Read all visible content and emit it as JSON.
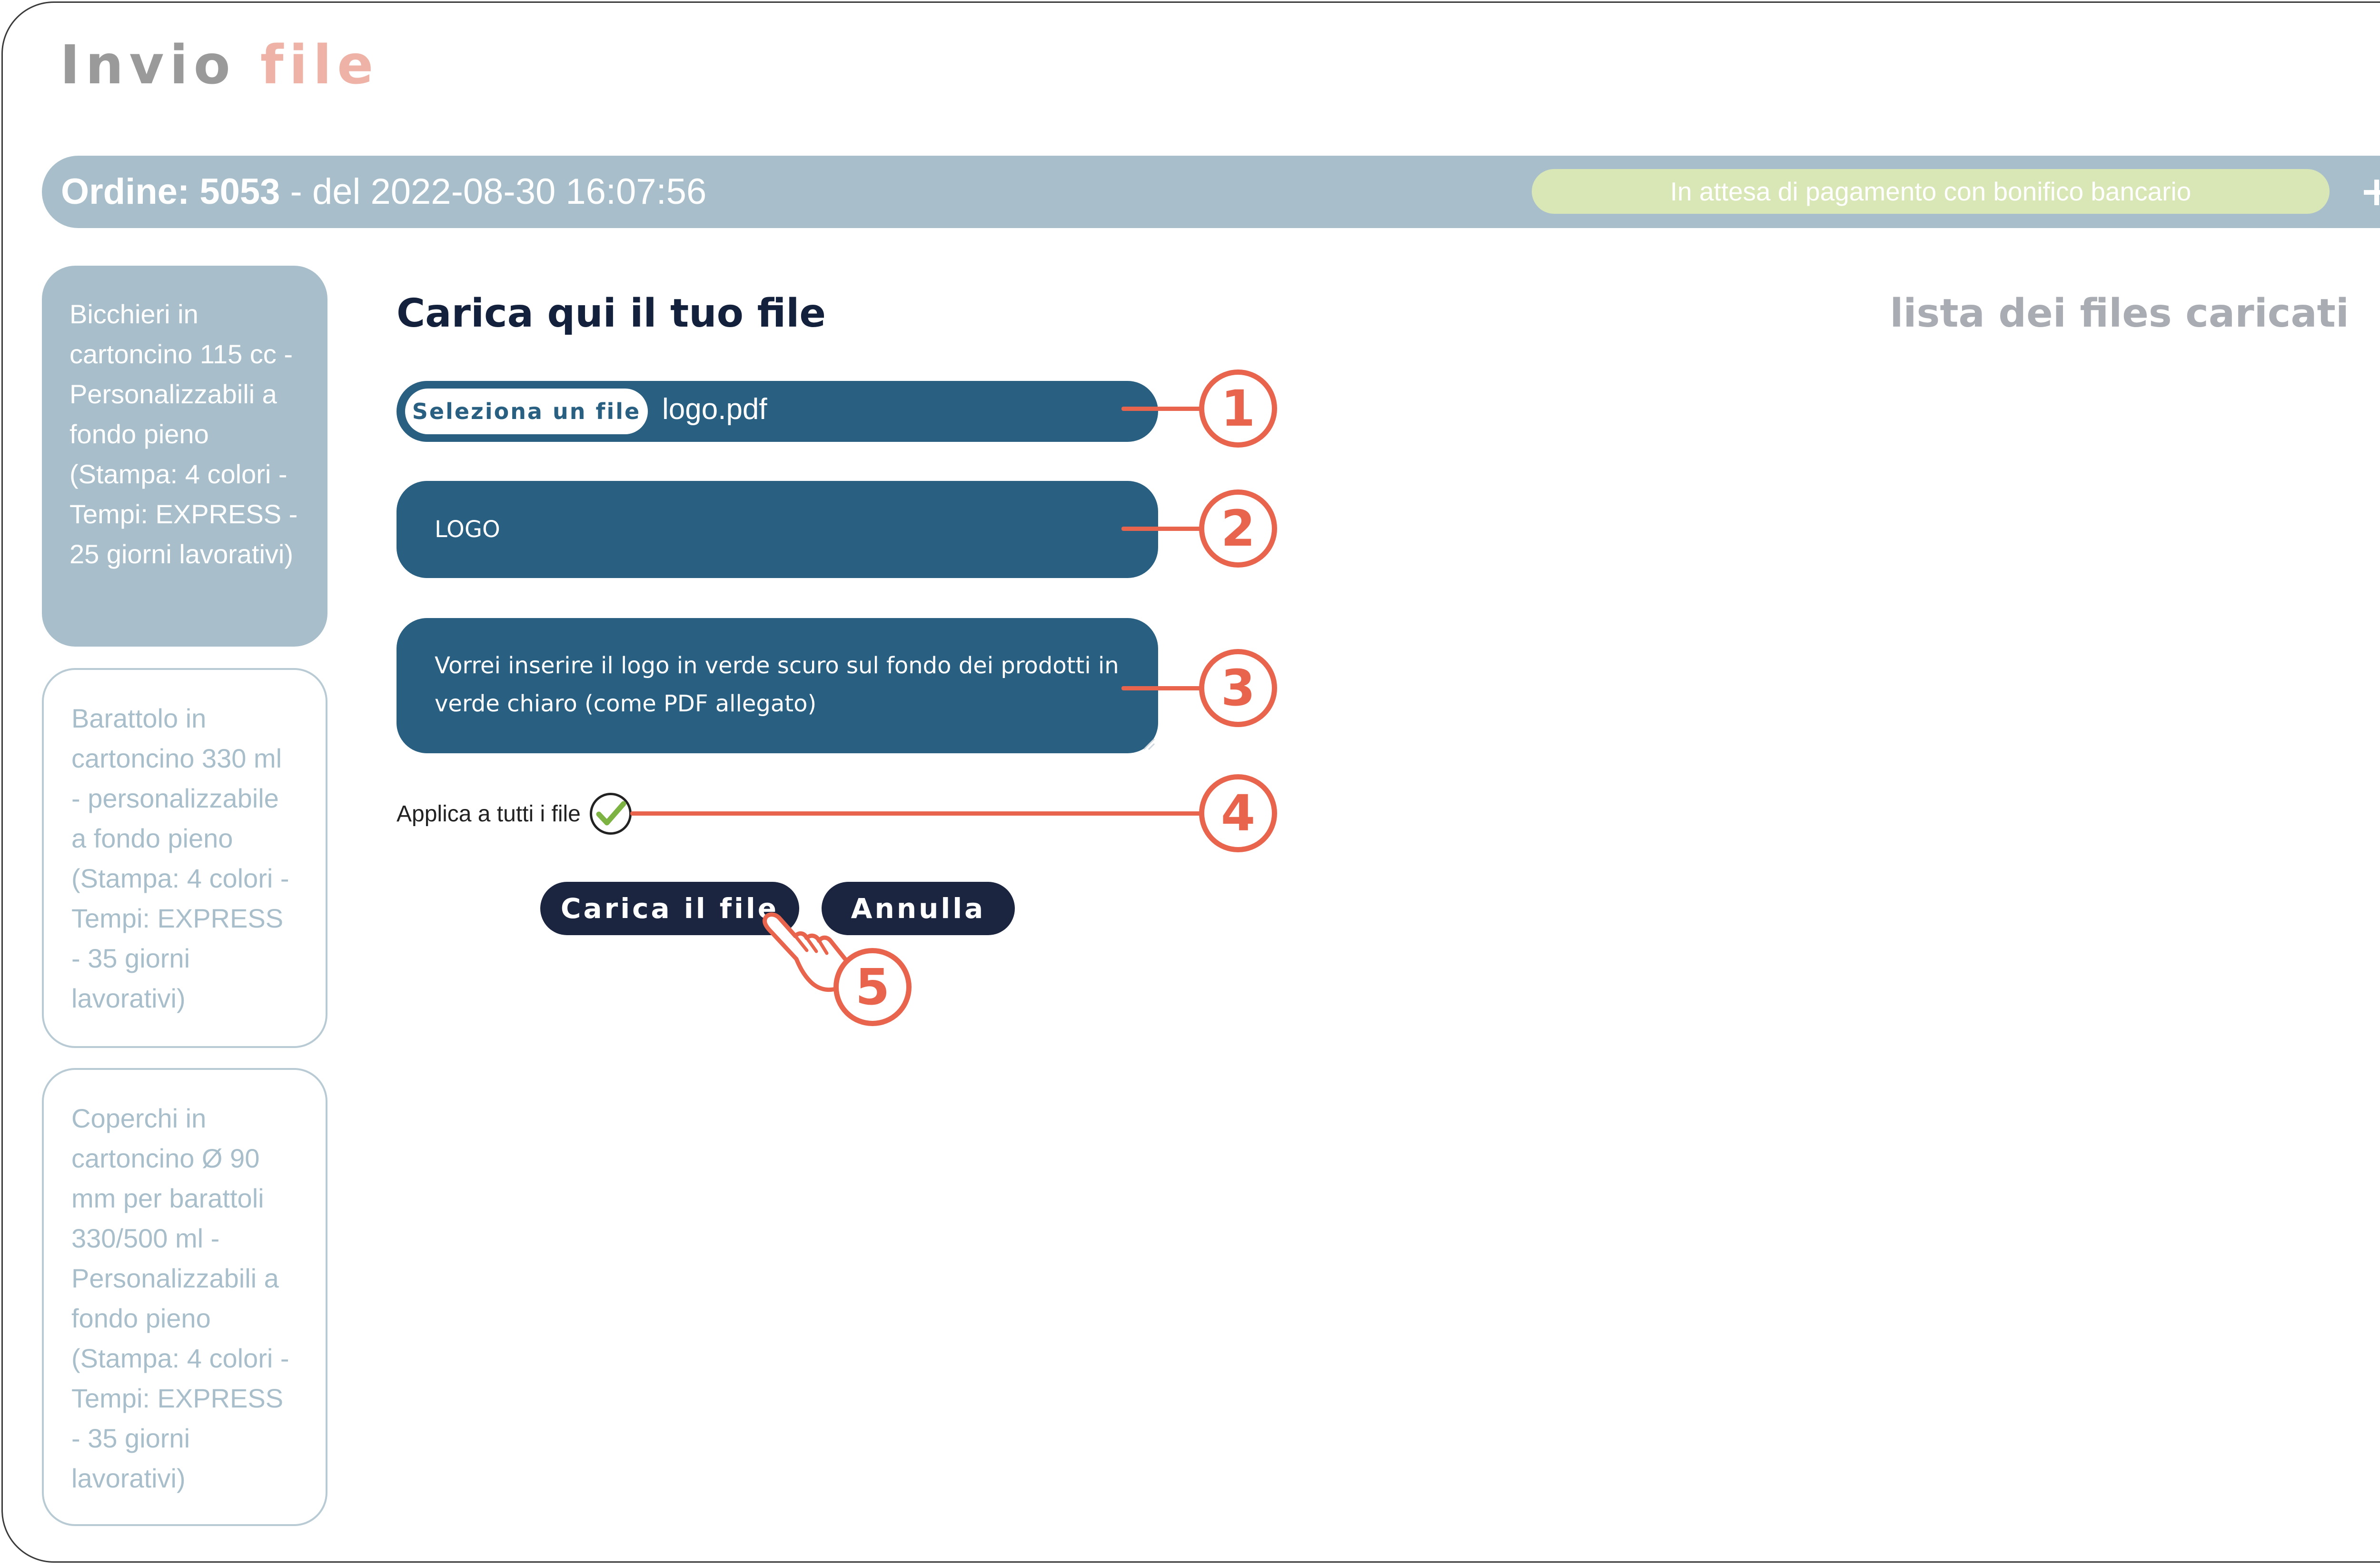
{
  "page_title": {
    "part1": "Invio",
    "part2": "file"
  },
  "order": {
    "label": "Ordine: 5053",
    "date_text": "- del 2022-08-30 16:07:56",
    "status": "In attesa di pagamento con bonifico bancario",
    "expand_icon": "+"
  },
  "products": [
    {
      "label": "Bicchieri in cartoncino 115 cc - Personalizzabili a fondo pieno (Stampa: 4 colori - Tempi: EXPRESS - 25 giorni lavorativi)",
      "active": true
    },
    {
      "label": "Barattolo in cartoncino 330 ml - personalizzabile a fondo pieno (Stampa: 4 colori - Tempi: EXPRESS - 35 giorni lavorativi)",
      "active": false
    },
    {
      "label": "Coperchi in cartoncino Ø 90 mm per barattoli 330/500 ml - Personalizzabili a fondo pieno (Stampa: 4 colori - Tempi: EXPRESS - 35 giorni lavorativi)",
      "active": false
    }
  ],
  "upload": {
    "title": "Carica qui il tuo file",
    "select_button": "Seleziona un file",
    "file_name": "logo.pdf",
    "name_value": "LOGO",
    "notes_value": "Vorrei inserire il logo in verde scuro sul fondo dei prodotti in verde chiaro (come PDF allegato)",
    "apply_all_label": "Applica a tutti i file",
    "apply_all_checked": true,
    "submit_label": "Carica il file",
    "cancel_label": "Annulla"
  },
  "files_list": {
    "title": "lista dei files caricati"
  },
  "annotations": [
    "1",
    "2",
    "3",
    "4",
    "5"
  ],
  "colors": {
    "accent": "#e8644d",
    "field": "#295f80",
    "button": "#1b2540",
    "bar": "#a8bfcb",
    "status": "#d8e7b5",
    "check": "#7cb342"
  }
}
